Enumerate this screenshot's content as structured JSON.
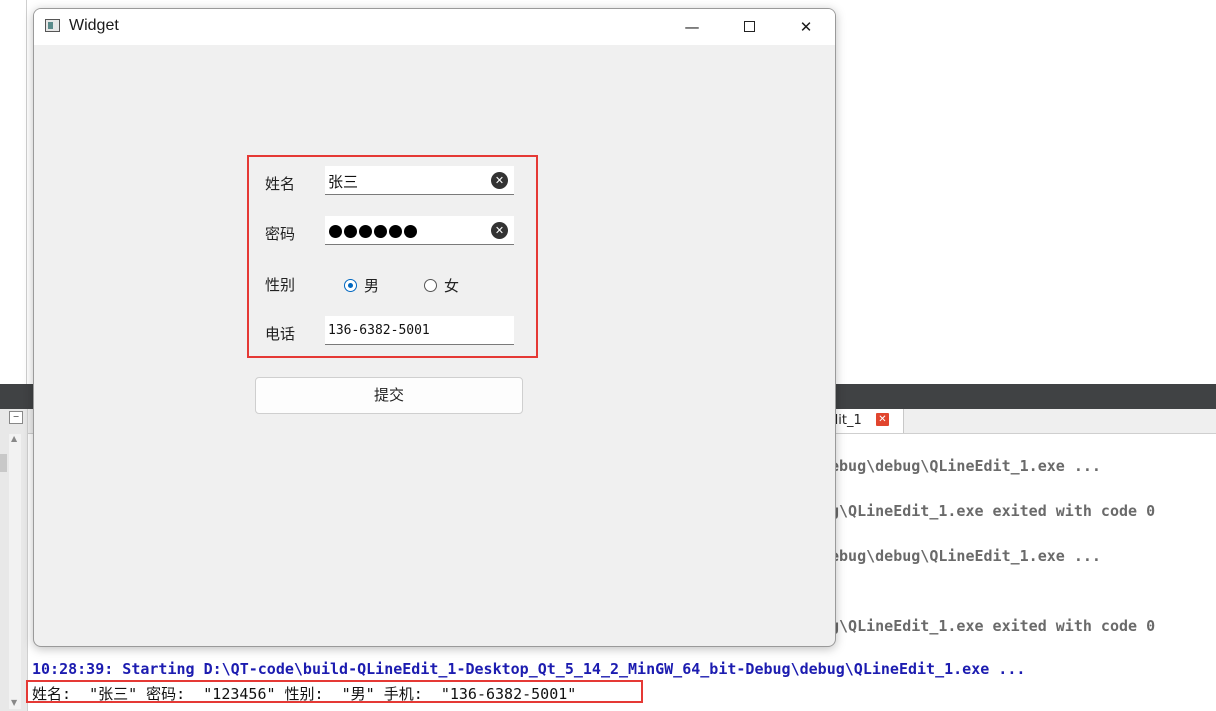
{
  "ide": {
    "tab_label": "dit_1",
    "output_lines": [
      "ebug\\debug\\QLineEdit_1.exe ...",
      "g\\QLineEdit_1.exe exited with code 0",
      "ebug\\debug\\QLineEdit_1.exe ...",
      "g\\QLineEdit_1.exe exited with code 0"
    ],
    "log_starting": "10:28:39: Starting D:\\QT-code\\build-QLineEdit_1-Desktop_Qt_5_14_2_MinGW_64_bit-Debug\\debug\\QLineEdit_1.exe ...",
    "log_result": "姓名:  \"张三\" 密码:  \"123456\" 性别:  \"男\" 手机:  \"136-6382-5001\""
  },
  "window": {
    "title": "Widget",
    "controls": {
      "minimize": "—",
      "close": "✕"
    }
  },
  "form": {
    "name_label": "姓名",
    "name_value": "张三",
    "password_label": "密码",
    "password_length": 6,
    "gender_label": "性别",
    "gender_options": [
      "男",
      "女"
    ],
    "gender_selected": "男",
    "phone_label": "电话",
    "phone_value": "136-6382-5001",
    "submit_label": "提交"
  },
  "colors": {
    "highlight_border": "#e53935",
    "radio_accent": "#0067c0",
    "log_blue": "#1c1cb0"
  }
}
